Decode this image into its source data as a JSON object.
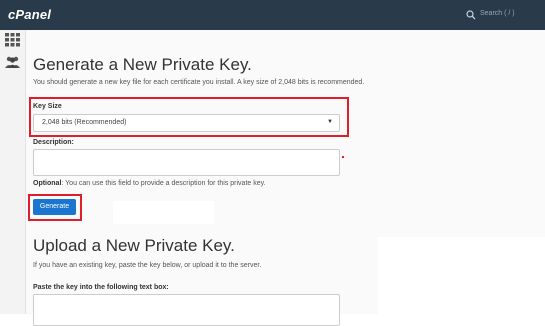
{
  "app": {
    "logo": "cPanel"
  },
  "search": {
    "placeholder": "Search ( / )",
    "icon": "search-icon"
  },
  "sidebar": {
    "items": [
      {
        "icon": "grid-icon"
      },
      {
        "icon": "users-icon"
      }
    ]
  },
  "generate_section": {
    "title": "Generate a New Private Key.",
    "intro": "You should generate a new key file for each certificate you install. A key size of 2,048 bits is recommended.",
    "key_size_label": "Key Size",
    "key_size_value": "2,048 bits (Recommended)",
    "description_label": "Description:",
    "description_value": "",
    "optional_label": "Optional",
    "optional_help": ": You can use this field to provide a description for this private key.",
    "generate_button": "Generate"
  },
  "upload_section": {
    "title": "Upload a New Private Key.",
    "intro": "If you have an existing key, paste the key below, or upload it to the server.",
    "paste_label": "Paste the key into the following text box:",
    "paste_value": ""
  },
  "colors": {
    "topbar": "#293a4a",
    "primary_button": "#1a75d1",
    "highlight": "#e01d2a"
  }
}
